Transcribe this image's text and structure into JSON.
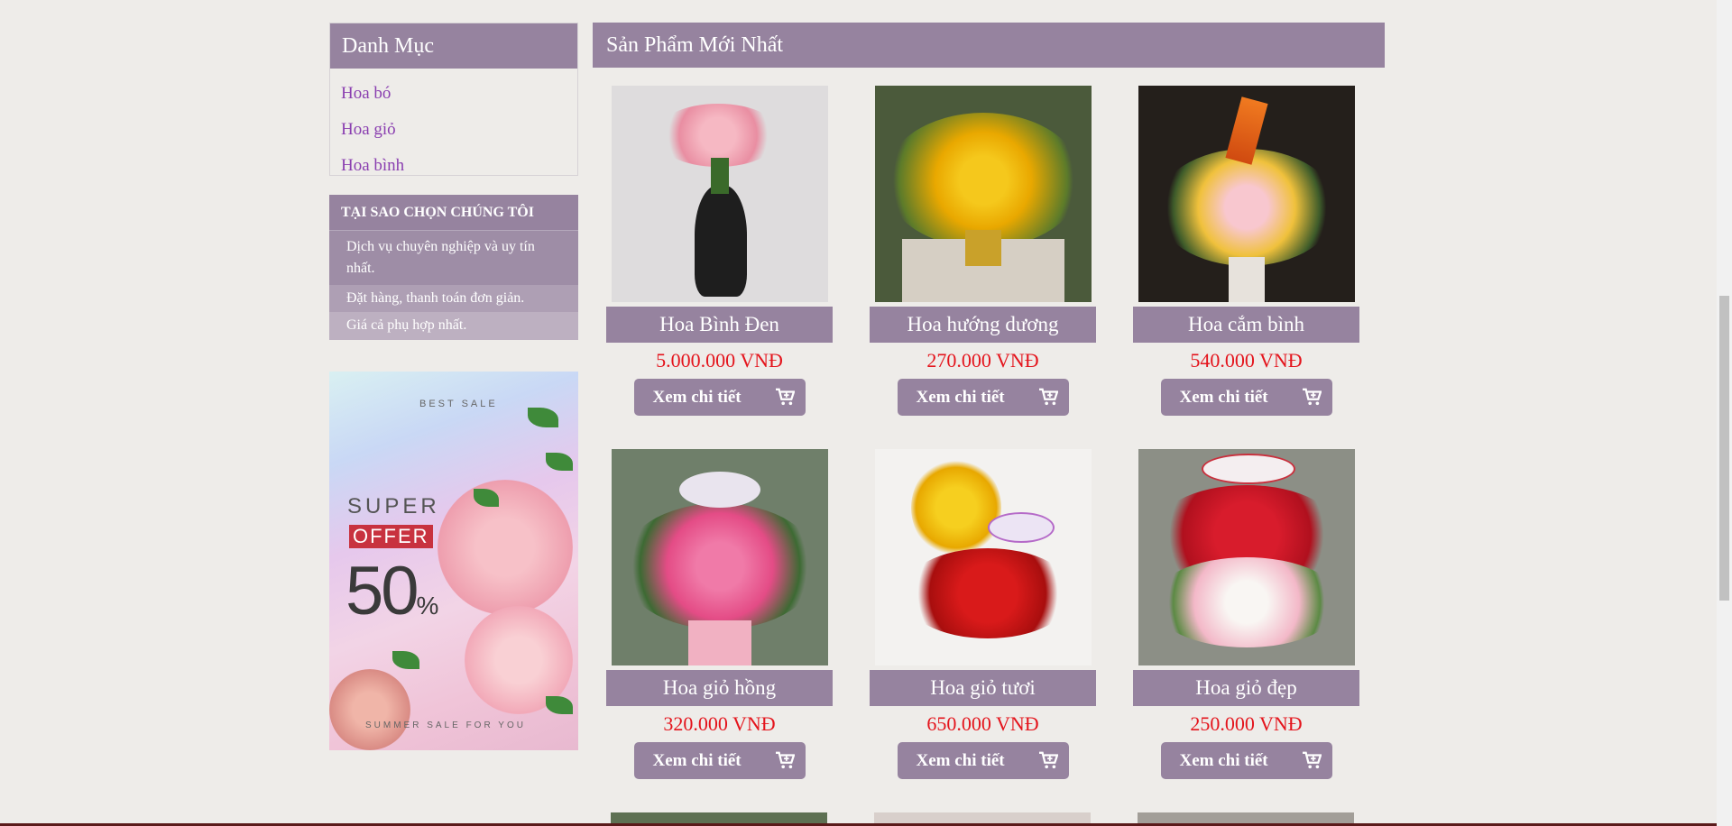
{
  "sidebar": {
    "categories_title": "Danh Mục",
    "categories": [
      {
        "label": "Hoa bó"
      },
      {
        "label": "Hoa giỏ"
      },
      {
        "label": "Hoa bình"
      }
    ],
    "why_title": "TẠI SAO CHỌN CHÚNG TÔI",
    "why_items": [
      {
        "text": "Dịch vụ chuyên nghiệp và uy tín nhất."
      },
      {
        "text": "Đặt hàng, thanh toán đơn giản."
      },
      {
        "text": "Giá cả phụ hợp nhất."
      }
    ],
    "promo": {
      "best": "BEST SALE",
      "super": "SUPER",
      "offer": "OFFER",
      "percent": "50",
      "percent_sign": "%",
      "summer": "SUMMER SALE FOR YOU"
    }
  },
  "main": {
    "title": "Sản Phẩm Mới Nhất",
    "button_label": "Xem chi tiết",
    "products": [
      {
        "name": "Hoa Bình Đen",
        "price": "5.000.000 VNĐ"
      },
      {
        "name": "Hoa hướng dương",
        "price": "270.000 VNĐ"
      },
      {
        "name": "Hoa cắm bình",
        "price": "540.000 VNĐ"
      },
      {
        "name": "Hoa giỏ hồng",
        "price": "320.000 VNĐ"
      },
      {
        "name": "Hoa giỏ tươi",
        "price": "650.000 VNĐ"
      },
      {
        "name": "Hoa giỏ đẹp",
        "price": "250.000 VNĐ"
      }
    ]
  },
  "colors": {
    "accent": "#96839f",
    "price": "#e4141c",
    "link": "#8a3fb0"
  }
}
